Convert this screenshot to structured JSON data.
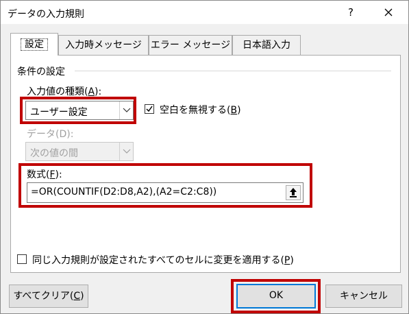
{
  "window": {
    "title": "データの入力規則",
    "help_label": "?"
  },
  "tabs": [
    {
      "label": "設定",
      "active": true
    },
    {
      "label": "入力時メッセージ",
      "active": false
    },
    {
      "label": "エラー メッセージ",
      "active": false
    },
    {
      "label": "日本語入力",
      "active": false
    }
  ],
  "conditions": {
    "group_label": "条件の設定",
    "allow_label_pre": "入力値の種類(",
    "allow_label_key": "A",
    "allow_label_post": "):",
    "allow_value": "ユーザー設定",
    "ignore_blank_pre": "空白を無視する(",
    "ignore_blank_key": "B",
    "ignore_blank_post": ")",
    "ignore_blank_checked": true,
    "data_label": "データ(D):",
    "data_value": "次の値の間",
    "formula_label_pre": "数式(",
    "formula_label_key": "F",
    "formula_label_post": "):",
    "formula_value": "=OR(COUNTIF(D2:D8,A2),(A2=C2:C8))"
  },
  "apply_all": {
    "label_pre": "同じ入力規則が設定されたすべてのセルに変更を適用する(",
    "label_key": "P",
    "label_post": ")",
    "checked": false
  },
  "buttons": {
    "clear_all_pre": "すべてクリア(",
    "clear_all_key": "C",
    "clear_all_post": ")",
    "ok": "OK",
    "cancel": "キャンセル"
  },
  "colors": {
    "highlight": "#c00000",
    "ok_focus": "#0078d7"
  }
}
